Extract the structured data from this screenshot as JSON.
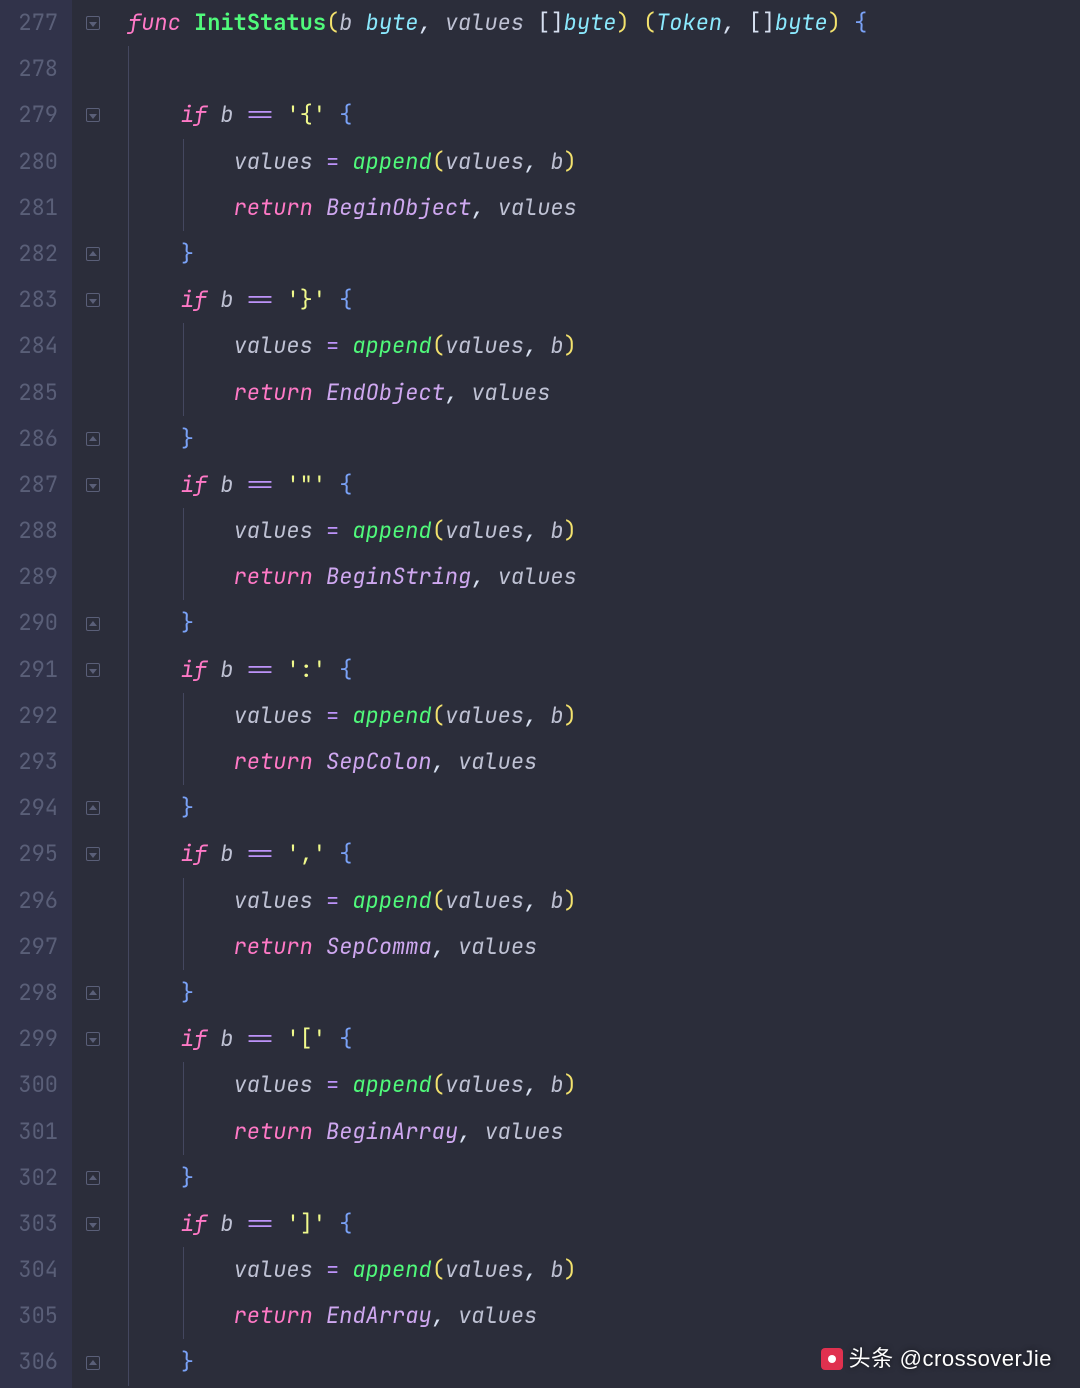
{
  "startLine": 277,
  "watermark": {
    "prefix": "头条",
    "handle": "@crossoverJie"
  },
  "lines": [
    {
      "fold": "open",
      "indents": [],
      "guides": [],
      "tokens": [
        [
          "k-func",
          "func "
        ],
        [
          "fn-name",
          "InitStatus"
        ],
        [
          "paren",
          "("
        ],
        [
          "var",
          "b"
        ],
        [
          "punc",
          " "
        ],
        [
          "type",
          "byte"
        ],
        [
          "comma",
          ", "
        ],
        [
          "var",
          "values"
        ],
        [
          "punc",
          " []"
        ],
        [
          "type",
          "byte"
        ],
        [
          "paren",
          ") ("
        ],
        [
          "type",
          "Token"
        ],
        [
          "comma",
          ", "
        ],
        [
          "punc",
          "[]"
        ],
        [
          "type",
          "byte"
        ],
        [
          "paren",
          ") "
        ],
        [
          "brace",
          "{"
        ]
      ]
    },
    {
      "fold": "",
      "indents": [
        0
      ],
      "guides": [
        0
      ],
      "tokens": []
    },
    {
      "fold": "open",
      "indents": [
        0
      ],
      "guides": [
        0
      ],
      "tokens": [
        [
          "punc",
          "    "
        ],
        [
          "k-if",
          "if"
        ],
        [
          "punc",
          " "
        ],
        [
          "var",
          "b"
        ],
        [
          "punc",
          " "
        ],
        [
          "eq",
          "=="
        ],
        [
          "punc",
          " "
        ],
        [
          "str",
          "'{'"
        ],
        [
          "punc",
          " "
        ],
        [
          "brace",
          "{"
        ]
      ]
    },
    {
      "fold": "",
      "indents": [
        0,
        1
      ],
      "guides": [
        0,
        1
      ],
      "tokens": [
        [
          "punc",
          "        "
        ],
        [
          "var",
          "values"
        ],
        [
          "punc",
          " "
        ],
        [
          "eq",
          "="
        ],
        [
          "punc",
          " "
        ],
        [
          "fn-call",
          "append"
        ],
        [
          "paren",
          "("
        ],
        [
          "var",
          "values"
        ],
        [
          "comma",
          ", "
        ],
        [
          "var",
          "b"
        ],
        [
          "paren",
          ")"
        ]
      ]
    },
    {
      "fold": "",
      "indents": [
        0,
        1
      ],
      "guides": [
        0,
        1
      ],
      "tokens": [
        [
          "punc",
          "        "
        ],
        [
          "k-return",
          "return"
        ],
        [
          "punc",
          " "
        ],
        [
          "token",
          "BeginObject"
        ],
        [
          "comma",
          ", "
        ],
        [
          "var",
          "values"
        ]
      ]
    },
    {
      "fold": "close",
      "indents": [
        0
      ],
      "guides": [
        0
      ],
      "tokens": [
        [
          "punc",
          "    "
        ],
        [
          "brace",
          "}"
        ]
      ]
    },
    {
      "fold": "open",
      "indents": [
        0
      ],
      "guides": [
        0
      ],
      "tokens": [
        [
          "punc",
          "    "
        ],
        [
          "k-if",
          "if"
        ],
        [
          "punc",
          " "
        ],
        [
          "var",
          "b"
        ],
        [
          "punc",
          " "
        ],
        [
          "eq",
          "=="
        ],
        [
          "punc",
          " "
        ],
        [
          "str",
          "'}'"
        ],
        [
          "punc",
          " "
        ],
        [
          "brace",
          "{"
        ]
      ]
    },
    {
      "fold": "",
      "indents": [
        0,
        1
      ],
      "guides": [
        0,
        1
      ],
      "tokens": [
        [
          "punc",
          "        "
        ],
        [
          "var",
          "values"
        ],
        [
          "punc",
          " "
        ],
        [
          "eq",
          "="
        ],
        [
          "punc",
          " "
        ],
        [
          "fn-call",
          "append"
        ],
        [
          "paren",
          "("
        ],
        [
          "var",
          "values"
        ],
        [
          "comma",
          ", "
        ],
        [
          "var",
          "b"
        ],
        [
          "paren",
          ")"
        ]
      ]
    },
    {
      "fold": "",
      "indents": [
        0,
        1
      ],
      "guides": [
        0,
        1
      ],
      "tokens": [
        [
          "punc",
          "        "
        ],
        [
          "k-return",
          "return"
        ],
        [
          "punc",
          " "
        ],
        [
          "token",
          "EndObject"
        ],
        [
          "comma",
          ", "
        ],
        [
          "var",
          "values"
        ]
      ]
    },
    {
      "fold": "close",
      "indents": [
        0
      ],
      "guides": [
        0
      ],
      "tokens": [
        [
          "punc",
          "    "
        ],
        [
          "brace",
          "}"
        ]
      ]
    },
    {
      "fold": "open",
      "indents": [
        0
      ],
      "guides": [
        0
      ],
      "tokens": [
        [
          "punc",
          "    "
        ],
        [
          "k-if",
          "if"
        ],
        [
          "punc",
          " "
        ],
        [
          "var",
          "b"
        ],
        [
          "punc",
          " "
        ],
        [
          "eq",
          "=="
        ],
        [
          "punc",
          " "
        ],
        [
          "str",
          "'\"'"
        ],
        [
          "punc",
          " "
        ],
        [
          "brace",
          "{"
        ]
      ]
    },
    {
      "fold": "",
      "indents": [
        0,
        1
      ],
      "guides": [
        0,
        1
      ],
      "tokens": [
        [
          "punc",
          "        "
        ],
        [
          "var",
          "values"
        ],
        [
          "punc",
          " "
        ],
        [
          "eq",
          "="
        ],
        [
          "punc",
          " "
        ],
        [
          "fn-call",
          "append"
        ],
        [
          "paren",
          "("
        ],
        [
          "var",
          "values"
        ],
        [
          "comma",
          ", "
        ],
        [
          "var",
          "b"
        ],
        [
          "paren",
          ")"
        ]
      ]
    },
    {
      "fold": "",
      "indents": [
        0,
        1
      ],
      "guides": [
        0,
        1
      ],
      "tokens": [
        [
          "punc",
          "        "
        ],
        [
          "k-return",
          "return"
        ],
        [
          "punc",
          " "
        ],
        [
          "token",
          "BeginString"
        ],
        [
          "comma",
          ", "
        ],
        [
          "var",
          "values"
        ]
      ]
    },
    {
      "fold": "close",
      "indents": [
        0
      ],
      "guides": [
        0
      ],
      "tokens": [
        [
          "punc",
          "    "
        ],
        [
          "brace",
          "}"
        ]
      ]
    },
    {
      "fold": "open",
      "indents": [
        0
      ],
      "guides": [
        0
      ],
      "tokens": [
        [
          "punc",
          "    "
        ],
        [
          "k-if",
          "if"
        ],
        [
          "punc",
          " "
        ],
        [
          "var",
          "b"
        ],
        [
          "punc",
          " "
        ],
        [
          "eq",
          "=="
        ],
        [
          "punc",
          " "
        ],
        [
          "str",
          "':'"
        ],
        [
          "punc",
          " "
        ],
        [
          "brace",
          "{"
        ]
      ]
    },
    {
      "fold": "",
      "indents": [
        0,
        1
      ],
      "guides": [
        0,
        1
      ],
      "tokens": [
        [
          "punc",
          "        "
        ],
        [
          "var",
          "values"
        ],
        [
          "punc",
          " "
        ],
        [
          "eq",
          "="
        ],
        [
          "punc",
          " "
        ],
        [
          "fn-call",
          "append"
        ],
        [
          "paren",
          "("
        ],
        [
          "var",
          "values"
        ],
        [
          "comma",
          ", "
        ],
        [
          "var",
          "b"
        ],
        [
          "paren",
          ")"
        ]
      ]
    },
    {
      "fold": "",
      "indents": [
        0,
        1
      ],
      "guides": [
        0,
        1
      ],
      "tokens": [
        [
          "punc",
          "        "
        ],
        [
          "k-return",
          "return"
        ],
        [
          "punc",
          " "
        ],
        [
          "token",
          "SepColon"
        ],
        [
          "comma",
          ", "
        ],
        [
          "var",
          "values"
        ]
      ]
    },
    {
      "fold": "close",
      "indents": [
        0
      ],
      "guides": [
        0
      ],
      "tokens": [
        [
          "punc",
          "    "
        ],
        [
          "brace",
          "}"
        ]
      ]
    },
    {
      "fold": "open",
      "indents": [
        0
      ],
      "guides": [
        0
      ],
      "tokens": [
        [
          "punc",
          "    "
        ],
        [
          "k-if",
          "if"
        ],
        [
          "punc",
          " "
        ],
        [
          "var",
          "b"
        ],
        [
          "punc",
          " "
        ],
        [
          "eq",
          "=="
        ],
        [
          "punc",
          " "
        ],
        [
          "str",
          "','"
        ],
        [
          "punc",
          " "
        ],
        [
          "brace",
          "{"
        ]
      ]
    },
    {
      "fold": "",
      "indents": [
        0,
        1
      ],
      "guides": [
        0,
        1
      ],
      "tokens": [
        [
          "punc",
          "        "
        ],
        [
          "var",
          "values"
        ],
        [
          "punc",
          " "
        ],
        [
          "eq",
          "="
        ],
        [
          "punc",
          " "
        ],
        [
          "fn-call",
          "append"
        ],
        [
          "paren",
          "("
        ],
        [
          "var",
          "values"
        ],
        [
          "comma",
          ", "
        ],
        [
          "var",
          "b"
        ],
        [
          "paren",
          ")"
        ]
      ]
    },
    {
      "fold": "",
      "indents": [
        0,
        1
      ],
      "guides": [
        0,
        1
      ],
      "tokens": [
        [
          "punc",
          "        "
        ],
        [
          "k-return",
          "return"
        ],
        [
          "punc",
          " "
        ],
        [
          "token",
          "SepComma"
        ],
        [
          "comma",
          ", "
        ],
        [
          "var",
          "values"
        ]
      ]
    },
    {
      "fold": "close",
      "indents": [
        0
      ],
      "guides": [
        0
      ],
      "tokens": [
        [
          "punc",
          "    "
        ],
        [
          "brace",
          "}"
        ]
      ]
    },
    {
      "fold": "open",
      "indents": [
        0
      ],
      "guides": [
        0
      ],
      "tokens": [
        [
          "punc",
          "    "
        ],
        [
          "k-if",
          "if"
        ],
        [
          "punc",
          " "
        ],
        [
          "var",
          "b"
        ],
        [
          "punc",
          " "
        ],
        [
          "eq",
          "=="
        ],
        [
          "punc",
          " "
        ],
        [
          "str",
          "'['"
        ],
        [
          "punc",
          " "
        ],
        [
          "brace",
          "{"
        ]
      ]
    },
    {
      "fold": "",
      "indents": [
        0,
        1
      ],
      "guides": [
        0,
        1
      ],
      "tokens": [
        [
          "punc",
          "        "
        ],
        [
          "var",
          "values"
        ],
        [
          "punc",
          " "
        ],
        [
          "eq",
          "="
        ],
        [
          "punc",
          " "
        ],
        [
          "fn-call",
          "append"
        ],
        [
          "paren",
          "("
        ],
        [
          "var",
          "values"
        ],
        [
          "comma",
          ", "
        ],
        [
          "var",
          "b"
        ],
        [
          "paren",
          ")"
        ]
      ]
    },
    {
      "fold": "",
      "indents": [
        0,
        1
      ],
      "guides": [
        0,
        1
      ],
      "tokens": [
        [
          "punc",
          "        "
        ],
        [
          "k-return",
          "return"
        ],
        [
          "punc",
          " "
        ],
        [
          "token",
          "BeginArray"
        ],
        [
          "comma",
          ", "
        ],
        [
          "var",
          "values"
        ]
      ]
    },
    {
      "fold": "close",
      "indents": [
        0
      ],
      "guides": [
        0
      ],
      "tokens": [
        [
          "punc",
          "    "
        ],
        [
          "brace",
          "}"
        ]
      ]
    },
    {
      "fold": "open",
      "indents": [
        0
      ],
      "guides": [
        0
      ],
      "tokens": [
        [
          "punc",
          "    "
        ],
        [
          "k-if",
          "if"
        ],
        [
          "punc",
          " "
        ],
        [
          "var",
          "b"
        ],
        [
          "punc",
          " "
        ],
        [
          "eq",
          "=="
        ],
        [
          "punc",
          " "
        ],
        [
          "str",
          "']'"
        ],
        [
          "punc",
          " "
        ],
        [
          "brace",
          "{"
        ]
      ]
    },
    {
      "fold": "",
      "indents": [
        0,
        1
      ],
      "guides": [
        0,
        1
      ],
      "tokens": [
        [
          "punc",
          "        "
        ],
        [
          "var",
          "values"
        ],
        [
          "punc",
          " "
        ],
        [
          "eq",
          "="
        ],
        [
          "punc",
          " "
        ],
        [
          "fn-call",
          "append"
        ],
        [
          "paren",
          "("
        ],
        [
          "var",
          "values"
        ],
        [
          "comma",
          ", "
        ],
        [
          "var",
          "b"
        ],
        [
          "paren",
          ")"
        ]
      ]
    },
    {
      "fold": "",
      "indents": [
        0,
        1
      ],
      "guides": [
        0,
        1
      ],
      "tokens": [
        [
          "punc",
          "        "
        ],
        [
          "k-return",
          "return"
        ],
        [
          "punc",
          " "
        ],
        [
          "token",
          "EndArray"
        ],
        [
          "comma",
          ", "
        ],
        [
          "var",
          "values"
        ]
      ]
    },
    {
      "fold": "close",
      "indents": [
        0
      ],
      "guides": [
        0
      ],
      "tokens": [
        [
          "punc",
          "    "
        ],
        [
          "brace",
          "}"
        ]
      ]
    }
  ]
}
